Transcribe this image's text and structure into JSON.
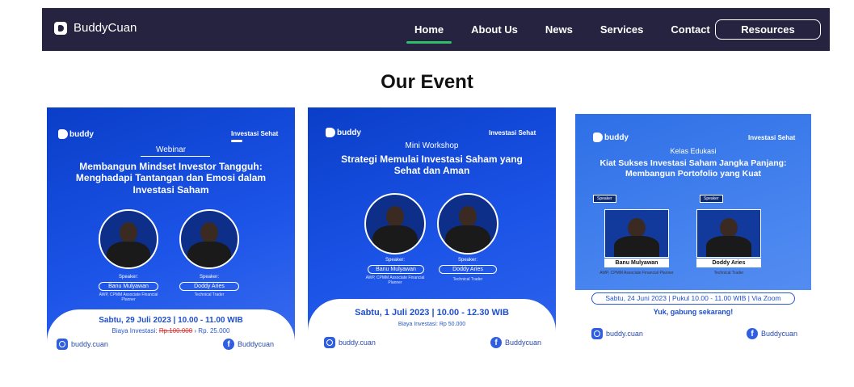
{
  "brand": {
    "name": "BuddyCuan"
  },
  "nav": {
    "items": [
      {
        "label": "Home",
        "active": true
      },
      {
        "label": "About Us",
        "active": false
      },
      {
        "label": "News",
        "active": false
      },
      {
        "label": "Services",
        "active": false
      },
      {
        "label": "Contact",
        "active": false
      }
    ],
    "resources_label": "Resources"
  },
  "section": {
    "title": "Our Event"
  },
  "events": [
    {
      "logo": "buddy",
      "tag": "Investasi Sehat",
      "subtitle": "Webinar",
      "title": "Membangun Mindset Investor Tangguh: Menghadapi Tantangan dan Emosi dalam Investasi Saham",
      "speaker_label": "Speaker:",
      "speakers": [
        {
          "name": "Banu Mulyawan",
          "role": "AWP, CPMM Associate Financial Planner"
        },
        {
          "name": "Doddy Aries",
          "role": "Technical Trader"
        }
      ],
      "date": "Sabtu, 29 Juli 2023 | 10.00 - 11.00 WIB",
      "price_label": "Biaya Investasi:",
      "price_old": "Rp.100.000",
      "price_new": "› Rp. 25.000",
      "instagram": "buddy.cuan",
      "facebook": "Buddycuan"
    },
    {
      "logo": "buddy",
      "tag": "Investasi Sehat",
      "subtitle": "Mini Workshop",
      "title": "Strategi Memulai Investasi Saham yang Sehat dan Aman",
      "speaker_label": "Speaker:",
      "speakers": [
        {
          "name": "Banu Mulyawan",
          "role": "AWP, CPMM Associate Financial Planner"
        },
        {
          "name": "Doddy Aries",
          "role": "Technical Trader"
        }
      ],
      "date": "Sabtu, 1 Juli 2023 | 10.00 - 12.30 WIB",
      "price": "Biaya Investasi: Rp 50.000",
      "instagram": "buddy.cuan",
      "facebook": "Buddycuan"
    },
    {
      "logo": "buddy",
      "tag": "Investasi Sehat",
      "subtitle": "Kelas Edukasi",
      "title": "Kiat Sukses Investasi Saham Jangka Panjang: Membangun Portofolio yang Kuat",
      "speaker_tag": "Speaker",
      "speakers": [
        {
          "name": "Banu Mulyawan",
          "role": "AWP, CPMM Associate Financial Planner"
        },
        {
          "name": "Doddy Aries",
          "role": "Technical Trader"
        }
      ],
      "date": "Sabtu, 24 Juni 2023 | Pukul 10.00 - 11.00 WIB | Via Zoom",
      "cta": "Yuk, gabung sekarang!",
      "instagram": "buddy.cuan",
      "facebook": "Buddycuan"
    }
  ],
  "colors": {
    "nav_bg": "#25233f",
    "active_underline": "#2fbf6b",
    "card_blue": "#1c54e8"
  }
}
